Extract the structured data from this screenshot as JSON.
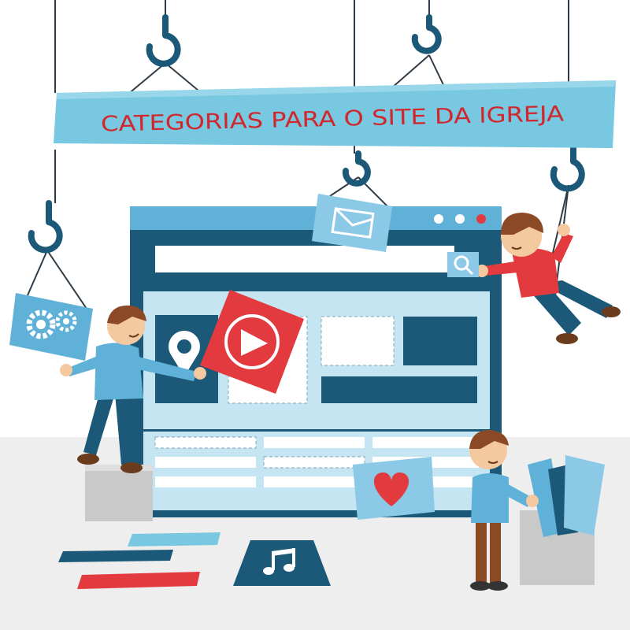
{
  "banner": {
    "title": "CATEGORIAS PARA O SITE DA IGREJA"
  },
  "colors": {
    "banner_bg": "#77c8e0",
    "title": "#d2262d",
    "navy": "#1c5878",
    "sky": "#5fb1d8",
    "pale": "#c6e5f3",
    "red": "#e23a3f",
    "floor": "#eeeeee",
    "skin": "#f5c9a0",
    "hair": "#8b4a25"
  },
  "icons": [
    "gears-icon",
    "location-pin-icon",
    "play-icon",
    "mail-icon",
    "search-icon",
    "heart-icon",
    "music-note-icon"
  ]
}
